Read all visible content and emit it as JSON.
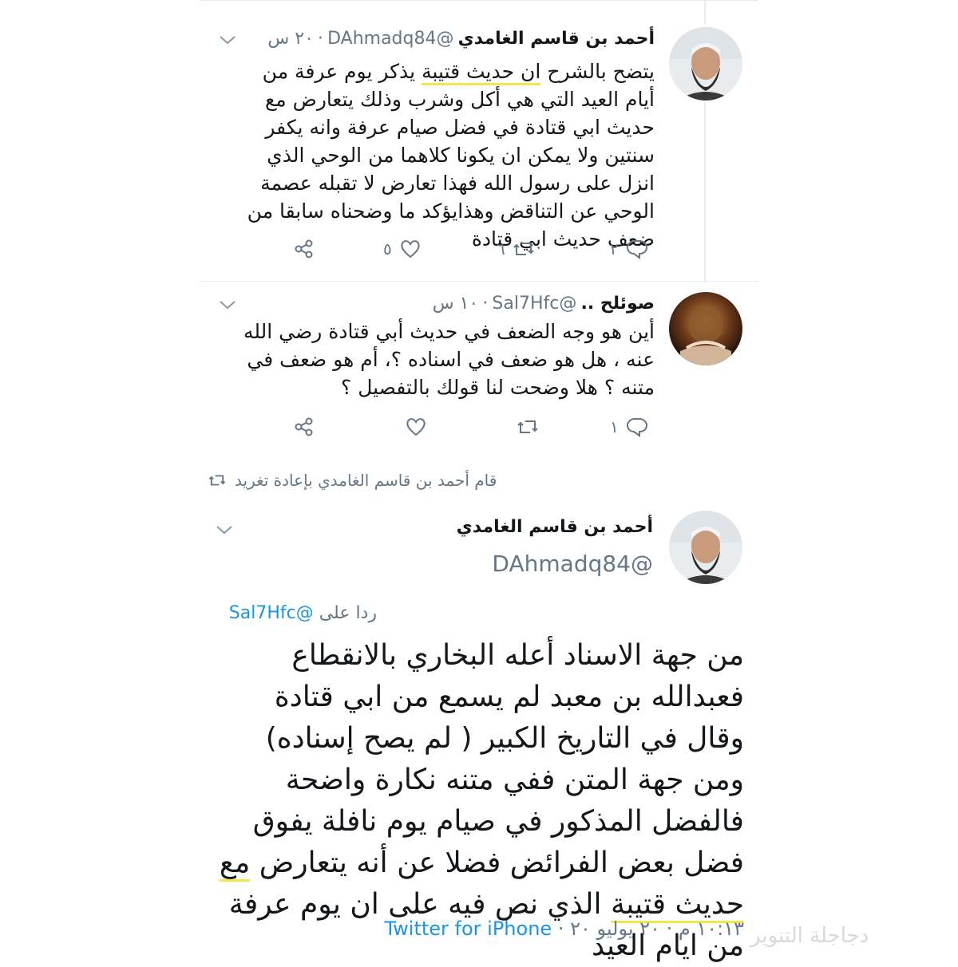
{
  "tweet1": {
    "display_name": "أحمد بن قاسم الغامدي",
    "handle": "@DAhmadq84",
    "time": "٢٠ س",
    "text_lead": "يتضح بالشرح ",
    "text_mark": "ان حديث قتيبة",
    "text_rest": " يذكر يوم عرفة من أيام العيد التي هي أكل وشرب وذلك يتعارض مع حديث ابي قتادة في فضل صيام عرفة وانه يكفر سنتين ولا يمكن ان يكونا كلاهما من الوحي الذي انزل على رسول الله فهذا تعارض لا تقبله عصمة الوحي عن التناقض وهذايؤكد ما وضحناه سابقا من ضعف حديث ابي قتادة",
    "replies": "٢",
    "retweets": "٦",
    "likes": "٥"
  },
  "tweet2": {
    "display_name": "صوئلح ..",
    "handle": "@Sal7Hfc",
    "time": "١٠ س",
    "text": "أين هو وجه الضعف في حديث أبي قتادة رضي الله عنه ، هل هو ضعف في اسناده ؟، أم هو ضعف في متنه ؟ هلا وضحت لنا قولك بالتفصيل ؟",
    "replies": "١"
  },
  "retweet_banner": "قام أحمد بن قاسم الغامدي بإعادة تغريد",
  "main_tweet": {
    "display_name": "أحمد بن قاسم الغامدي",
    "handle": "@DAhmadq84",
    "reply_prefix": "ردا على",
    "reply_handle": "@Sal7Hfc",
    "text_lead": "من جهة الاسناد أعله البخاري بالانقطاع فعبدالله بن معبد لم يسمع من ابي قتادة وقال في التاريخ الكبير ( لم يصح إسناده) ومن جهة المتن ففي متنه نكارة واضحة فالفضل المذكور في صيام يوم نافلة يفوق فضل بعض الفرائض فضلا عن أنه يتعارض ",
    "text_mark": "مع حديث قتيبة",
    "text_rest": " الذي نص فيه على ان يوم عرفة من ايام العيد",
    "timestamp": "١٠:١٣ م · ٢٠ يوليو ٢٠",
    "source": "Twitter for iPhone"
  },
  "watermark": "دجاجلة التنوير",
  "colors": {
    "accent": "#1b95e0",
    "highlight": "#f5e64a",
    "secondary_text": "#657786"
  }
}
